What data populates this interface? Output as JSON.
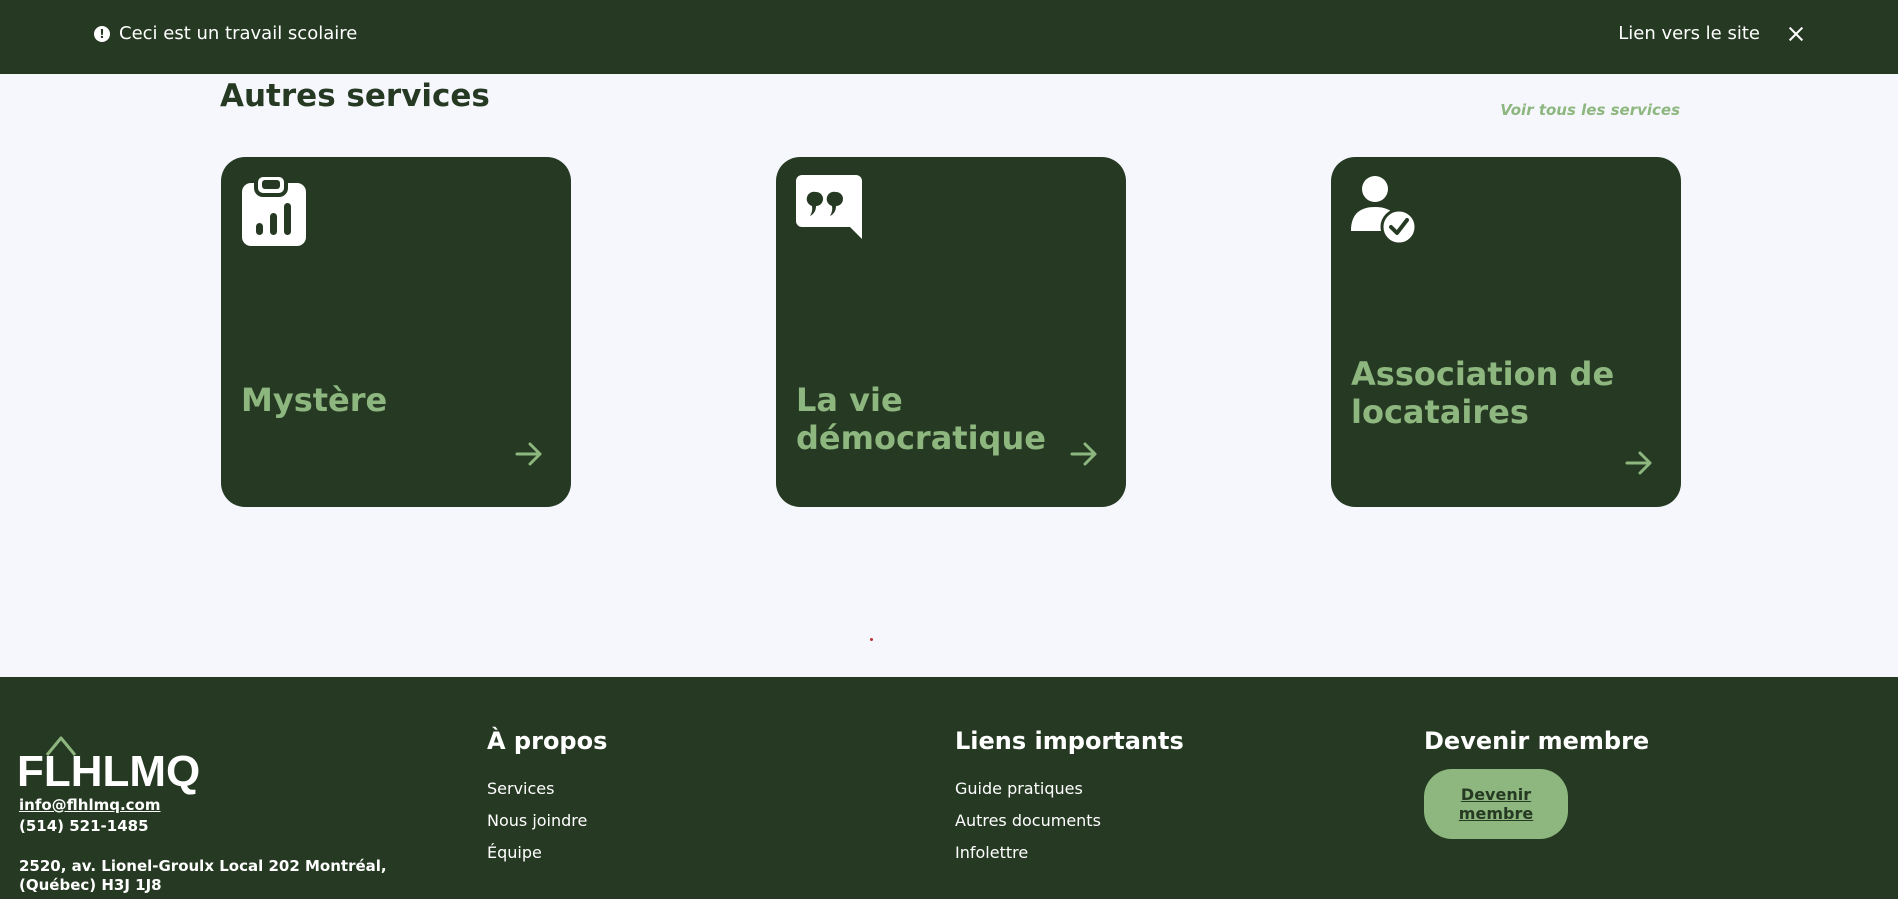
{
  "banner": {
    "notice": "Ceci est un travail scolaire",
    "site_link": "Lien vers le site"
  },
  "services": {
    "title": "Autres services",
    "see_all": "Voir tous les services",
    "cards": [
      {
        "title": "Mystère",
        "icon": "clipboard-chart-icon"
      },
      {
        "title": "La vie démocratique",
        "icon": "quote-bubble-icon"
      },
      {
        "title": "Association de locataires",
        "icon": "user-check-icon"
      }
    ]
  },
  "footer": {
    "logo": "FLHLMQ",
    "email": "info@flhlmq.com",
    "phone": "(514) 521-1485",
    "address": "2520, av. Lionel-Groulx Local 202 Montréal, (Québec) H3J 1J8",
    "about": {
      "title": "À propos",
      "links": [
        "Services",
        "Nous joindre",
        "Équipe"
      ]
    },
    "important": {
      "title": "Liens importants",
      "links": [
        "Guide pratiques",
        "Autres documents",
        "Infolettre"
      ]
    },
    "member": {
      "title": "Devenir membre",
      "button": "Devenir membre"
    }
  },
  "colors": {
    "dark_green": "#263a23",
    "light_green": "#8db77f",
    "background": "#f6f7fd"
  }
}
